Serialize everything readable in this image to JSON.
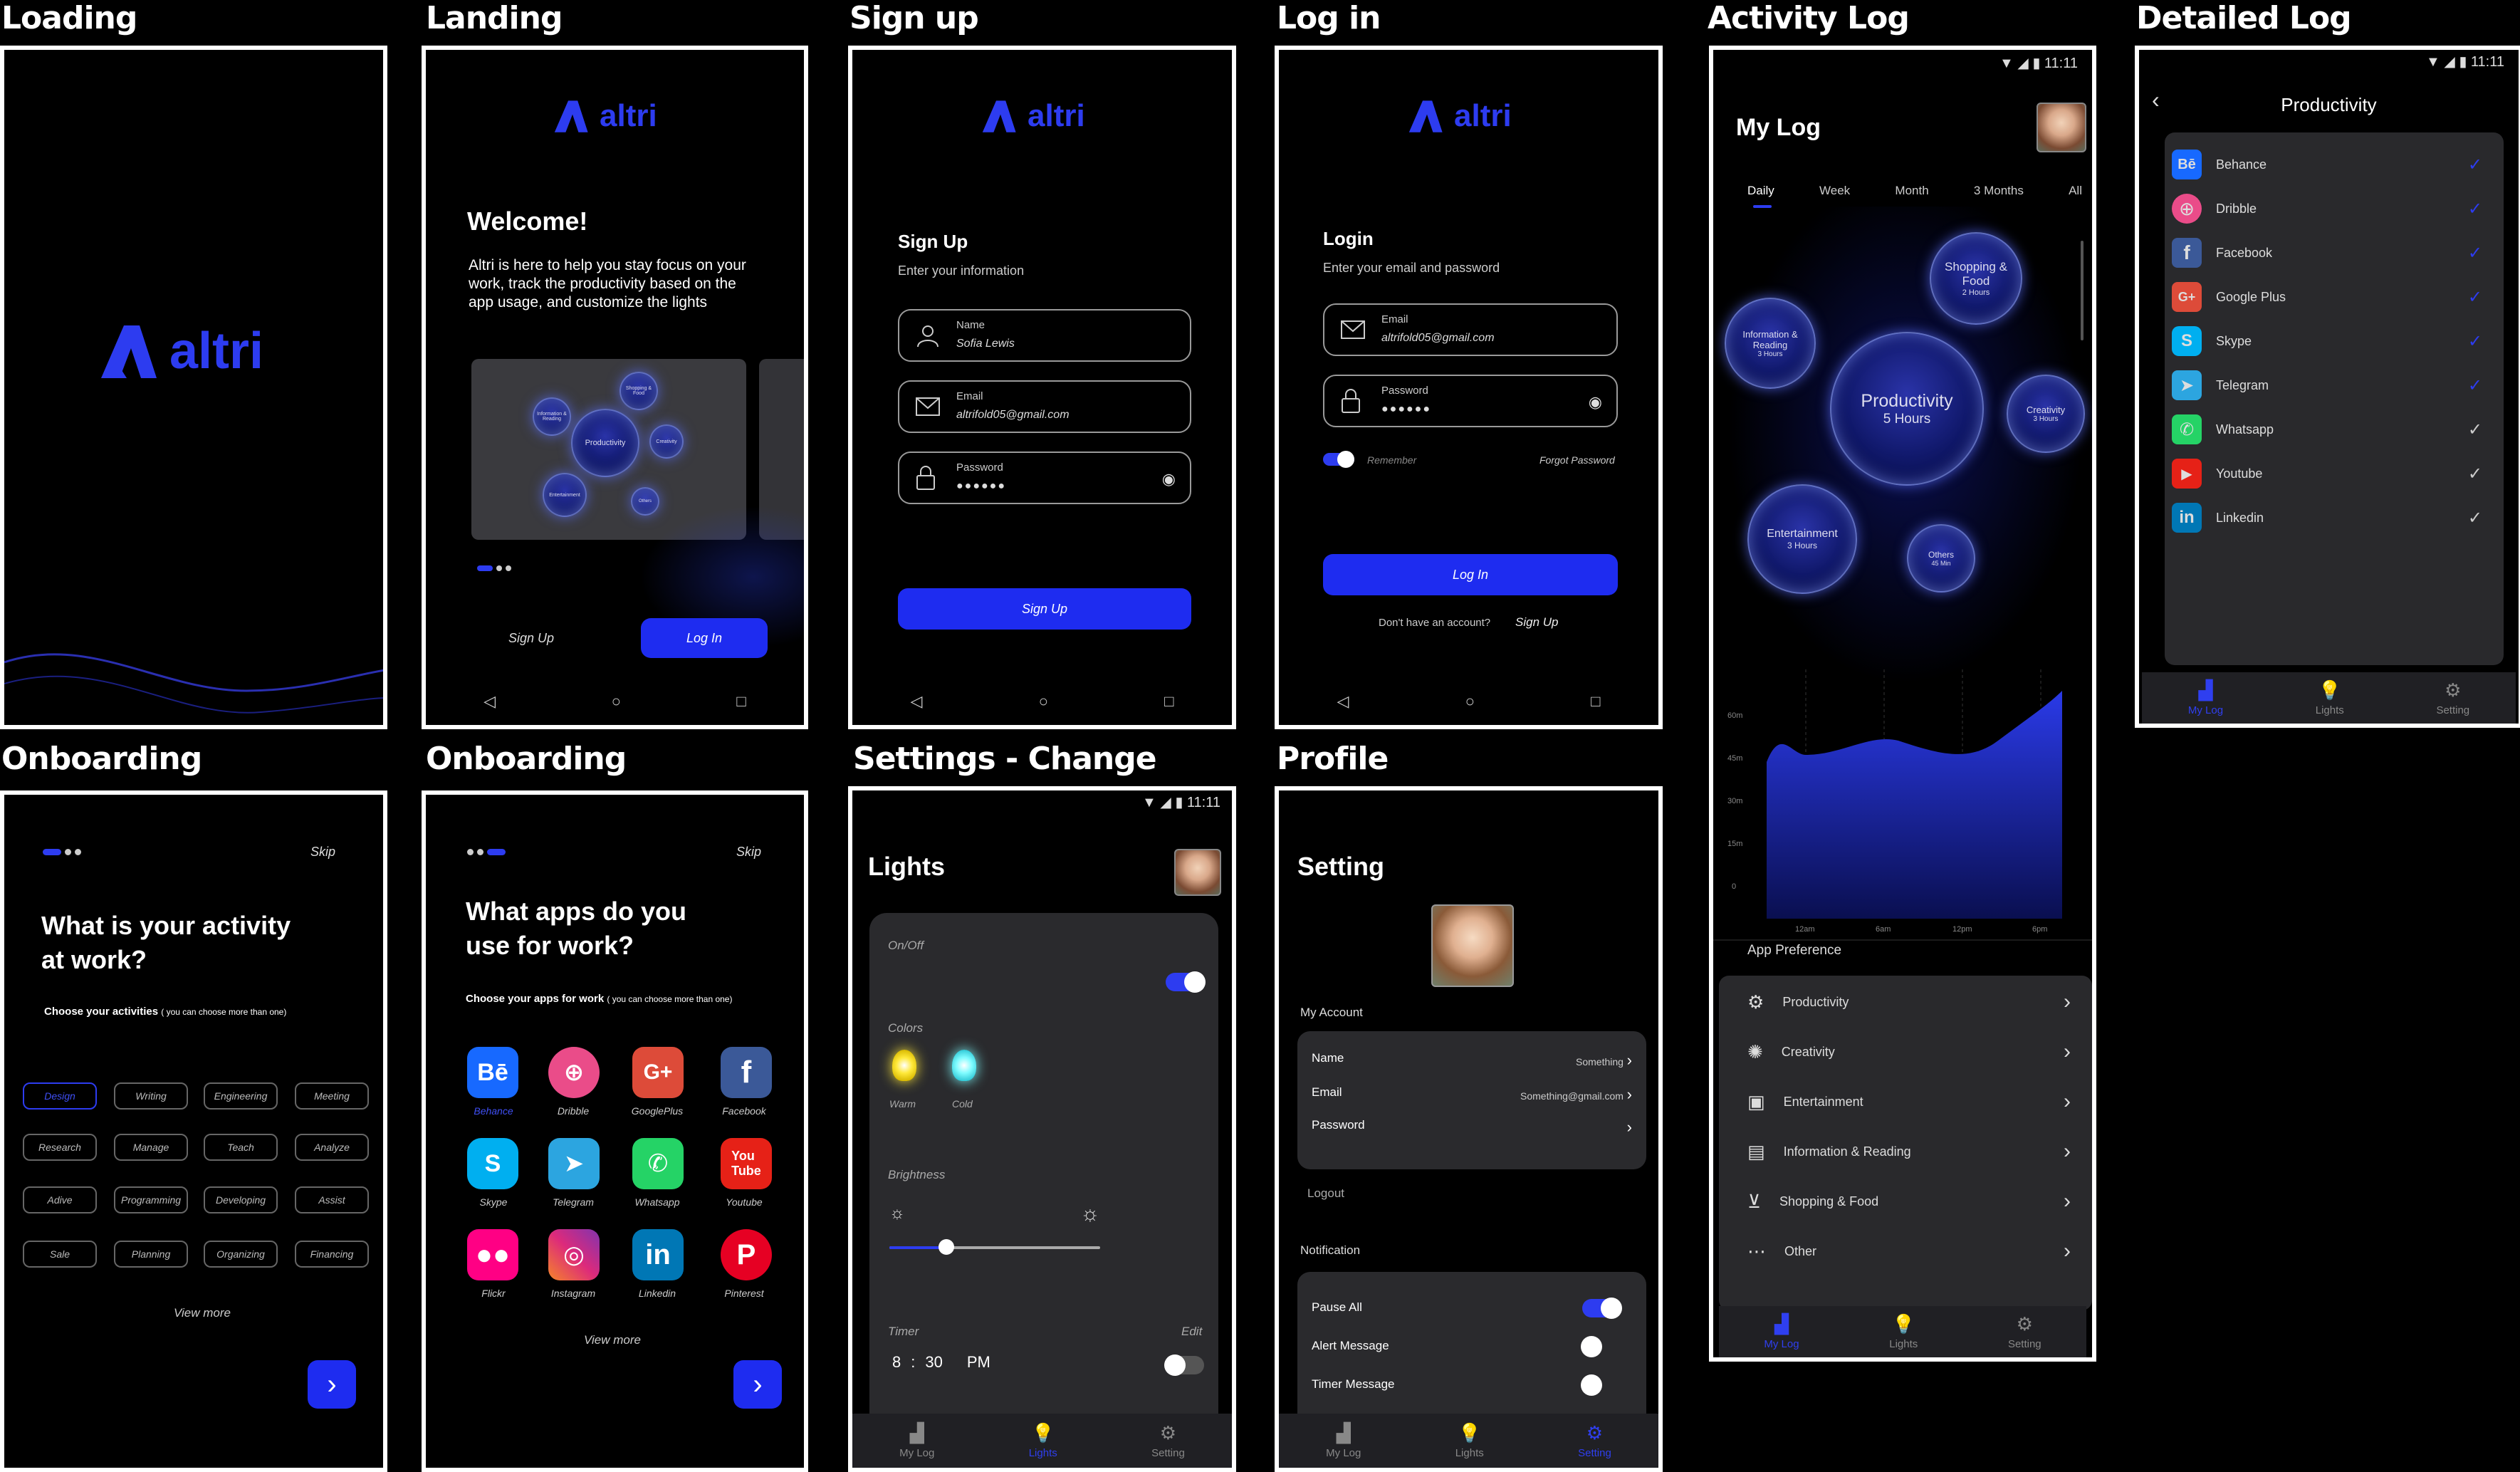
{
  "titles": {
    "loading": "Loading",
    "landing": "Landing",
    "signup": "Sign up",
    "login": "Log in",
    "activity_log": "Activity Log",
    "detailed_log": "Detailed Log",
    "onboarding1": "Onboarding",
    "onboarding2": "Onboarding",
    "settings_change": "Settings - Change",
    "profile": "Profile"
  },
  "brand": {
    "name": "altri",
    "accent": "#1e2cf0"
  },
  "status_bar": {
    "time": "11:11"
  },
  "landing": {
    "welcome": "Welcome!",
    "desc": "Altri is here to help you stay focus on your work, track the productivity based on the app usage, and customize the lights",
    "preview_bubbles": [
      "Productivity",
      "Shopping & Food",
      "Information & Reading",
      "Creativity",
      "Entertainment",
      "Others"
    ],
    "signup_label": "Sign Up",
    "login_label": "Log In"
  },
  "signup": {
    "heading": "Sign Up",
    "sub": "Enter your information",
    "name_label": "Name",
    "name_value": "Sofia Lewis",
    "email_label": "Email",
    "email_value": "altrifold05@gmail.com",
    "password_label": "Password",
    "password_value": "●●●●●●",
    "button": "Sign Up"
  },
  "login": {
    "heading": "Login",
    "sub": "Enter your email and password",
    "email_label": "Email",
    "email_value": "altrifold05@gmail.com",
    "password_label": "Password",
    "password_value": "●●●●●●",
    "remember": "Remember",
    "forgot": "Forgot Password",
    "button": "Log In",
    "no_account": "Don't have an account?",
    "signup_link": "Sign Up"
  },
  "mylog": {
    "title": "My Log",
    "tabs": [
      "Daily",
      "Week",
      "Month",
      "3 Months",
      "All"
    ],
    "bubbles": [
      {
        "name": "Shopping & Food",
        "time": "2 Hours"
      },
      {
        "name": "Information & Reading",
        "time": "3 Hours"
      },
      {
        "name": "Productivity",
        "time": "5 Hours"
      },
      {
        "name": "Creativity",
        "time": "3 Hours"
      },
      {
        "name": "Entertainment",
        "time": "3 Hours"
      },
      {
        "name": "Others",
        "time": "45 Min"
      }
    ],
    "chart_y_ticks": [
      "60m",
      "45m",
      "30m",
      "15m",
      "0"
    ],
    "chart_x_ticks": [
      "12am",
      "6am",
      "12pm",
      "6pm"
    ],
    "pref_title": "App Preference",
    "prefs": [
      "Productivity",
      "Creativity",
      "Entertainment",
      "Information & Reading",
      "Shopping & Food",
      "Other"
    ]
  },
  "detailed": {
    "title": "Productivity",
    "apps": [
      "Behance",
      "Dribble",
      "Facebook",
      "Google Plus",
      "Skype",
      "Telegram",
      "Whatsapp",
      "Youtube",
      "Linkedin"
    ]
  },
  "tabs": {
    "mylog": "My Log",
    "lights": "Lights",
    "setting": "Setting"
  },
  "onboarding1": {
    "skip": "Skip",
    "question": "What is your activity at work?",
    "choose": "Choose your activities",
    "choose_note": "( you can choose more than one)",
    "chips": [
      "Design",
      "Writing",
      "Engineering",
      "Meeting",
      "Research",
      "Manage",
      "Teach",
      "Analyze",
      "Adive",
      "Programming",
      "Developing",
      "Assist",
      "Sale",
      "Planning",
      "Organizing",
      "Financing"
    ],
    "view_more": "View more"
  },
  "onboarding2": {
    "skip": "Skip",
    "question": "What apps do you use for work?",
    "choose": "Choose your apps for work",
    "choose_note": "( you can choose more than one)",
    "apps": [
      "Behance",
      "Dribble",
      "GooglePlus",
      "Facebook",
      "Skype",
      "Telegram",
      "Whatsapp",
      "Youtube",
      "Flickr",
      "Instagram",
      "Linkedin",
      "Pinterest"
    ],
    "view_more": "View more"
  },
  "lights": {
    "title": "Lights",
    "onoff": "On/Off",
    "colors": "Colors",
    "warm": "Warm",
    "cold": "Cold",
    "brightness": "Brightness",
    "brightness_level": 0.27,
    "timer": "Timer",
    "edit": "Edit",
    "timer_h": "8",
    "timer_m": "30",
    "timer_pm": "PM"
  },
  "setting": {
    "title": "Setting",
    "my_account": "My Account",
    "name_label": "Name",
    "name_value": "Something",
    "email_label": "Email",
    "email_value": "Something@gmail.com",
    "password_label": "Password",
    "logout": "Logout",
    "notification": "Notification",
    "pause_all": "Pause All",
    "alert": "Alert Message",
    "timer_msg": "Timer Message"
  }
}
